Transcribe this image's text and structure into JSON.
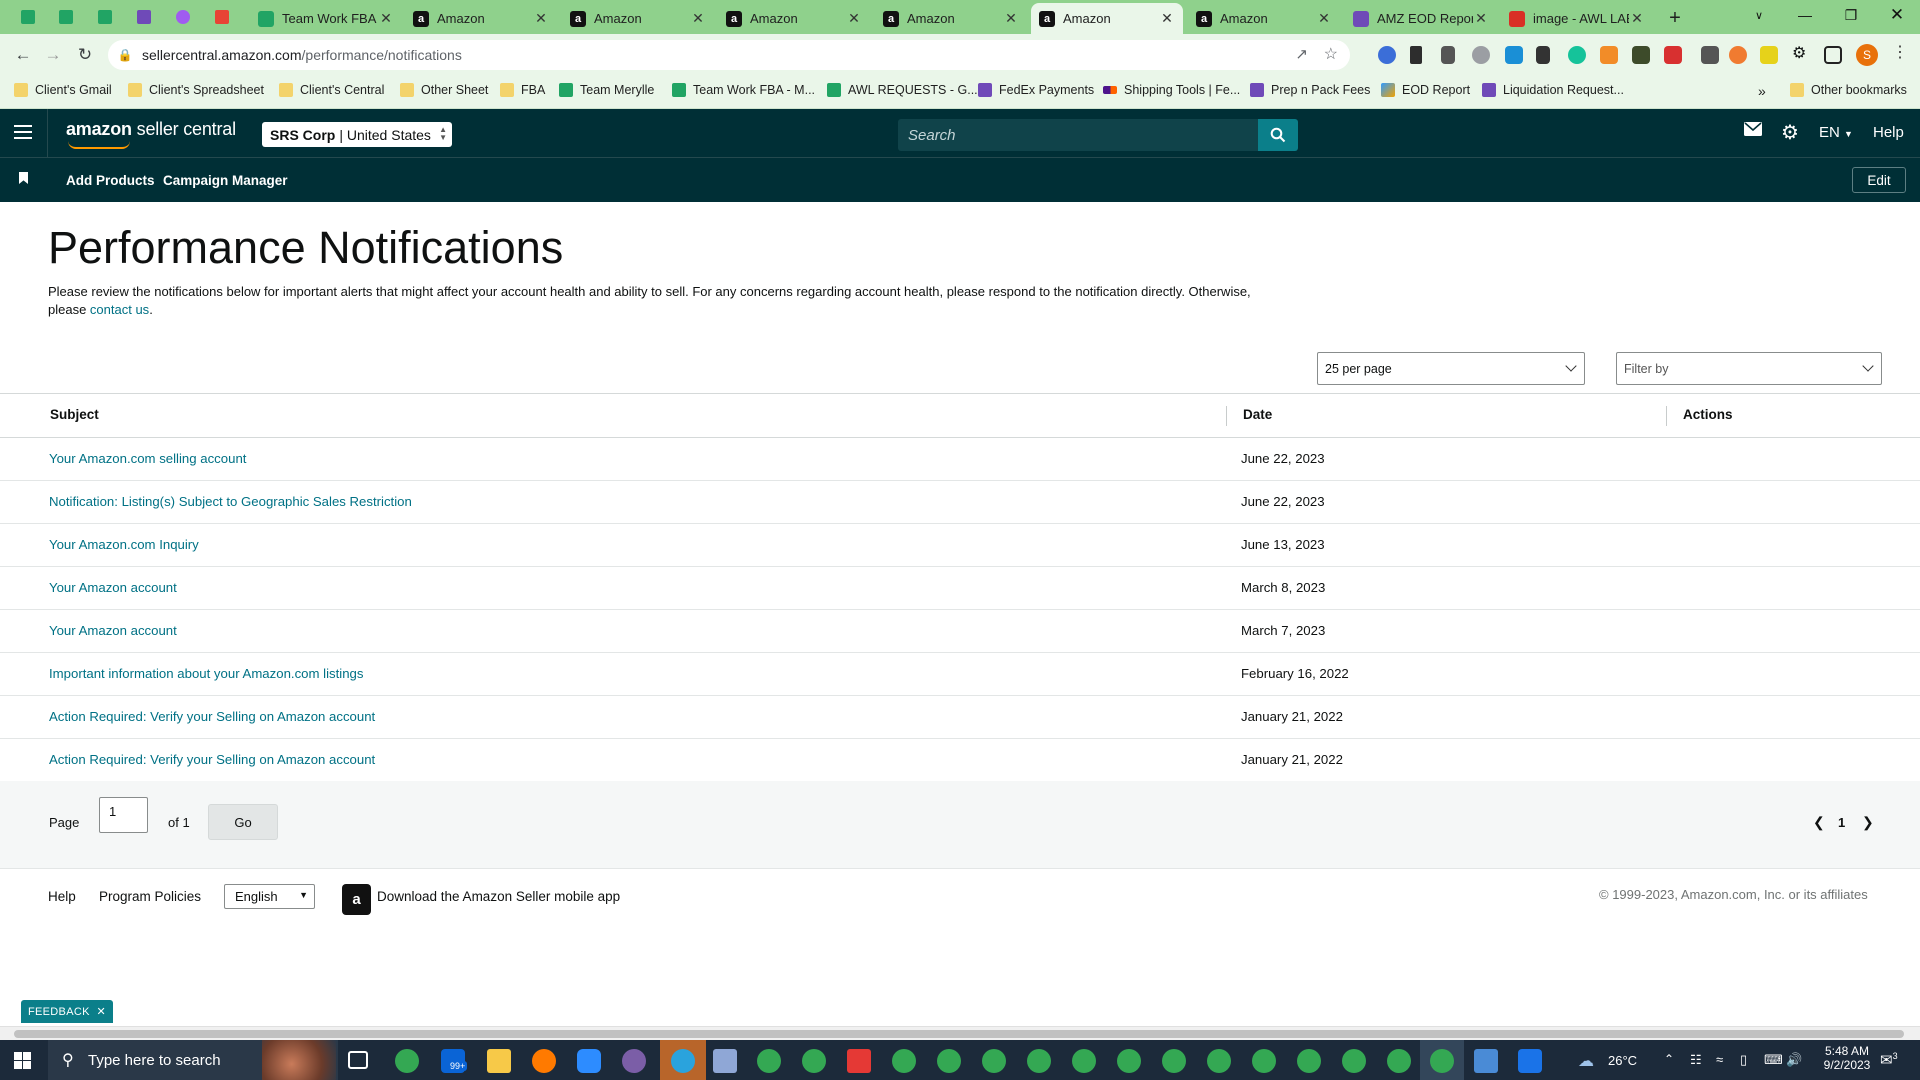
{
  "browser": {
    "tabs": [
      {
        "title": "Team Work FBA -",
        "icon": "sheets",
        "active": false
      },
      {
        "title": "Amazon",
        "icon": "amazon",
        "active": false
      },
      {
        "title": "Amazon",
        "icon": "amazon",
        "active": false
      },
      {
        "title": "Amazon",
        "icon": "amazon",
        "active": false
      },
      {
        "title": "Amazon",
        "icon": "amazon",
        "active": false
      },
      {
        "title": "Amazon",
        "icon": "amazon",
        "active": true
      },
      {
        "title": "Amazon",
        "icon": "amazon",
        "active": false
      },
      {
        "title": "AMZ EOD Report",
        "icon": "forms",
        "active": false
      },
      {
        "title": "image - AWL LAB",
        "icon": "gmail",
        "active": false
      }
    ],
    "url_host": "sellercentral.amazon.com",
    "url_path": "/performance/notifications",
    "bookmarks": [
      {
        "label": "Client's Gmail",
        "type": "folder"
      },
      {
        "label": "Client's Spreadsheet",
        "type": "folder"
      },
      {
        "label": "Client's Central",
        "type": "folder"
      },
      {
        "label": "Other Sheet",
        "type": "folder"
      },
      {
        "label": "FBA",
        "type": "folder"
      },
      {
        "label": "Team Merylle",
        "type": "sheet"
      },
      {
        "label": "Team Work FBA - M...",
        "type": "sheet"
      },
      {
        "label": "AWL REQUESTS - G...",
        "type": "sheet"
      },
      {
        "label": "FedEx Payments",
        "type": "form"
      },
      {
        "label": "Shipping Tools | Fe...",
        "type": "fedex"
      },
      {
        "label": "Prep n Pack Fees",
        "type": "form"
      },
      {
        "label": "EOD Report",
        "type": "report"
      },
      {
        "label": "Liquidation Request...",
        "type": "form"
      }
    ],
    "other_bookmarks": "Other bookmarks",
    "bookmarks_overflow": "»",
    "profile_initial": "S"
  },
  "header": {
    "logo_brand": "amazon",
    "logo_suffix": "seller central",
    "account_name": "SRS Corp",
    "account_region": "United States",
    "search_placeholder": "Search",
    "language": "EN",
    "help": "Help",
    "nav_links": [
      "Add Products",
      "Campaign Manager"
    ],
    "edit": "Edit"
  },
  "page": {
    "title": "Performance Notifications",
    "intro_text": "Please review the notifications below for important alerts that might affect your account health and ability to sell. For any concerns regarding account health, please respond to the notification directly. Otherwise, please ",
    "intro_link": "contact us",
    "intro_end": ".",
    "per_page": "25 per page",
    "filter_placeholder": "Filter by"
  },
  "table": {
    "columns": [
      "Subject",
      "Date",
      "Actions"
    ],
    "rows": [
      {
        "subject": "Your Amazon.com selling account",
        "date": "June 22, 2023"
      },
      {
        "subject": "Notification: Listing(s) Subject to Geographic Sales Restriction",
        "date": "June 22, 2023"
      },
      {
        "subject": "Your Amazon.com Inquiry",
        "date": "June 13, 2023"
      },
      {
        "subject": "Your Amazon account",
        "date": "March 8, 2023"
      },
      {
        "subject": "Your Amazon account",
        "date": "March 7, 2023"
      },
      {
        "subject": "Important information about your Amazon.com listings",
        "date": "February 16, 2022"
      },
      {
        "subject": "Action Required: Verify your Selling on Amazon account",
        "date": "January 21, 2022"
      },
      {
        "subject": "Action Required: Verify your Selling on Amazon account",
        "date": "January 21, 2022"
      }
    ]
  },
  "pagination": {
    "page_label": "Page",
    "page_value": "1",
    "of_label": "of 1",
    "go": "Go",
    "current": "1"
  },
  "footer": {
    "help": "Help",
    "policies": "Program Policies",
    "language": "English",
    "app_text": "Download the Amazon Seller mobile app",
    "copyright": "© 1999-2023, Amazon.com, Inc. or its affiliates"
  },
  "feedback": "FEEDBACK",
  "taskbar": {
    "search_placeholder": "Type here to search",
    "weather": "26°C",
    "time": "5:48 AM",
    "date": "9/2/2023",
    "mail_badge": "99+",
    "notifications": "3"
  },
  "colors": {
    "header_bg": "#002f36",
    "link": "#007185",
    "accent": "#ff9900",
    "search_btn": "#0b7f8a"
  }
}
